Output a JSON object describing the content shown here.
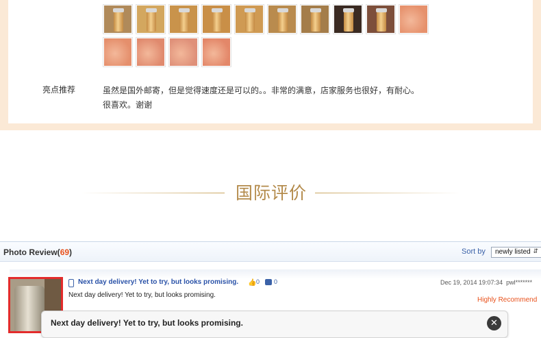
{
  "top_review": {
    "thumbnails": [
      {
        "icon": "cup-photo-icon",
        "color": "#b08a5a"
      },
      {
        "icon": "cup-photo-icon",
        "color": "#d3a75f"
      },
      {
        "icon": "cup-photo-icon",
        "color": "#c9934b"
      },
      {
        "icon": "cup-photo-icon",
        "color": "#c98f47"
      },
      {
        "icon": "cup-photo-icon",
        "color": "#cf9a53"
      },
      {
        "icon": "cup-photo-icon",
        "color": "#b98b4e"
      },
      {
        "icon": "cup-photo-icon",
        "color": "#a47d4a"
      },
      {
        "icon": "cup-photo-icon",
        "color": "#3a2a22"
      },
      {
        "icon": "cup-photo-icon",
        "color": "#7d4f3b"
      },
      {
        "icon": "skin-photo-icon",
        "color": "#e6916c"
      },
      {
        "icon": "skin-photo-icon",
        "color": "#e58f6c"
      },
      {
        "icon": "skin-photo-icon",
        "color": "#e08a6e"
      },
      {
        "icon": "skin-photo-icon",
        "color": "#df9079"
      },
      {
        "icon": "skin-photo-icon",
        "color": "#e38769"
      }
    ],
    "highlight_label": "亮点推荐",
    "highlight_line1": "虽然是国外邮寄，但是觉得速度还是可以的。。非常的满意，店家服务也很好，有耐心。",
    "highlight_line2": "很喜欢。谢谢"
  },
  "section": {
    "title": "国际评价"
  },
  "photo_review": {
    "title": "Photo Review(",
    "count": "69",
    "title_end": ")",
    "sort_label": "Sort by",
    "sort_value": "newly listed",
    "review": {
      "title": "Next day delivery! Yet to try, but looks promising.",
      "likes": "0",
      "comments": "0",
      "date": "Dec 19, 2014 19:07:34",
      "user": "pwl*******",
      "text": "Next day delivery! Yet to try, but looks promising.",
      "recommendation": "Highly Recommend"
    },
    "popup_text": "Next day delivery! Yet to try, but looks promising."
  },
  "colors": {
    "accent_orange": "#e8501a",
    "link_blue": "#2a52a8",
    "gold": "#b38a4a"
  }
}
